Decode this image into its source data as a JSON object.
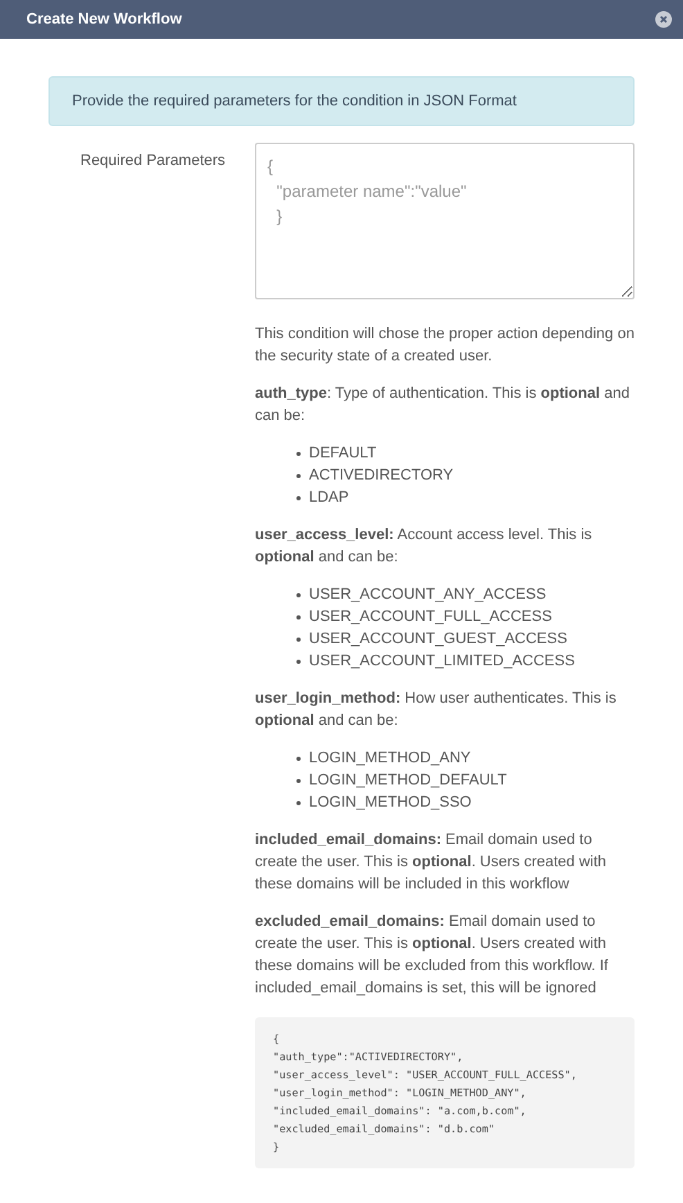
{
  "window": {
    "title": "Create New Workflow"
  },
  "alert": "Provide the required parameters for the condition in JSON Format",
  "field": {
    "label": "Required Parameters",
    "placeholder": "{\n  \"parameter name\":\"value\"\n  }"
  },
  "help": [
    {
      "kind": "text",
      "text": "This condition will chose the proper action depending on the security state of a created user."
    },
    {
      "kind": "text",
      "text": "**auth_type**: Type of authentication. This is **optional** and can be:"
    },
    {
      "kind": "list",
      "items": [
        "DEFAULT",
        "ACTIVEDIRECTORY",
        "LDAP"
      ]
    },
    {
      "kind": "text",
      "text": "**user_access_level:** Account access level. This is **optional** and can be:"
    },
    {
      "kind": "list",
      "items": [
        "USER_ACCOUNT_ANY_ACCESS",
        "USER_ACCOUNT_FULL_ACCESS",
        "USER_ACCOUNT_GUEST_ACCESS",
        "USER_ACCOUNT_LIMITED_ACCESS"
      ]
    },
    {
      "kind": "text",
      "text": "**user_login_method:** How user authenticates. This is **optional** and can be:"
    },
    {
      "kind": "list",
      "items": [
        "LOGIN_METHOD_ANY",
        "LOGIN_METHOD_DEFAULT",
        "LOGIN_METHOD_SSO"
      ]
    },
    {
      "kind": "text",
      "text": "**included_email_domains:** Email domain used to create the user. This is **optional**. Users created with these domains will be included in this workflow"
    },
    {
      "kind": "text",
      "text": "**excluded_email_domains:** Email domain used to create the user. This is **optional**. Users created with these domains will be excluded from this workflow. If included_email_domains is set, this will be ignored"
    },
    {
      "kind": "code",
      "lines": [
        "{",
        "\"auth_type\":\"ACTIVEDIRECTORY\",",
        "\"user_access_level\": \"USER_ACCOUNT_FULL_ACCESS\",",
        "\"user_login_method\": \"LOGIN_METHOD_ANY\",",
        "\"included_email_domains\": \"a.com,b.com\",",
        "\"excluded_email_domains\": \"d.b.com\"",
        "}"
      ]
    }
  ]
}
